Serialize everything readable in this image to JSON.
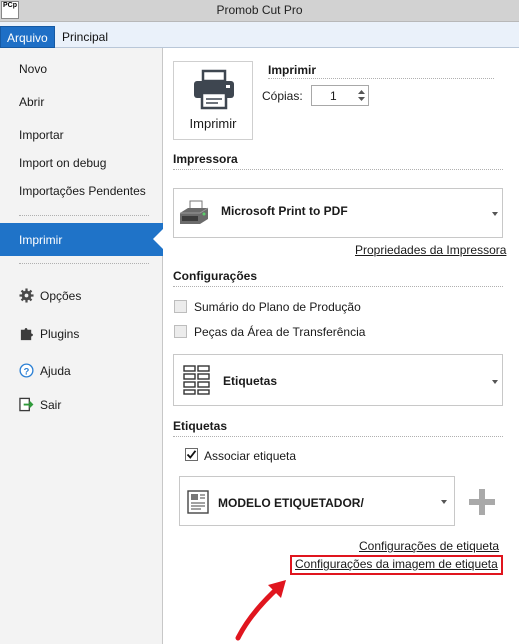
{
  "window": {
    "title": "Promob Cut Pro",
    "app_icon_text": "PCp"
  },
  "ribbon": {
    "tabs": [
      {
        "label": "Arquivo"
      },
      {
        "label": "Principal"
      }
    ]
  },
  "sidebar": {
    "items": [
      {
        "label": "Novo"
      },
      {
        "label": "Abrir"
      },
      {
        "label": "Importar"
      },
      {
        "label": "Import on debug"
      },
      {
        "label": "Importações Pendentes"
      }
    ],
    "active": {
      "label": "Imprimir"
    },
    "bottom_items": [
      {
        "label": "Opções",
        "icon": "gear-icon"
      },
      {
        "label": "Plugins",
        "icon": "puzzle-icon"
      },
      {
        "label": "Ajuda",
        "icon": "help-icon"
      },
      {
        "label": "Sair",
        "icon": "exit-icon"
      }
    ]
  },
  "print": {
    "button_label": "Imprimir",
    "heading": "Imprimir",
    "copies_label": "Cópias:",
    "copies_value": "1"
  },
  "printer": {
    "heading": "Impressora",
    "selected": "Microsoft Print to PDF",
    "properties_link": "Propriedades da Impressora"
  },
  "settings": {
    "heading": "Configurações",
    "options": [
      {
        "label": "Sumário do Plano de Produção",
        "checked": false
      },
      {
        "label": "Peças da Área de Transferência",
        "checked": false
      }
    ],
    "report_type": "Etiquetas"
  },
  "labels": {
    "heading": "Etiquetas",
    "associate_label": "Associar etiqueta",
    "associate_checked": true,
    "model": "MODELO ETIQUETADOR/",
    "config_link": "Configurações de etiqueta",
    "image_config_link": "Configurações da imagem de etiqueta"
  },
  "colors": {
    "accent": "#1f73c8",
    "annotation": "#e0151e"
  }
}
